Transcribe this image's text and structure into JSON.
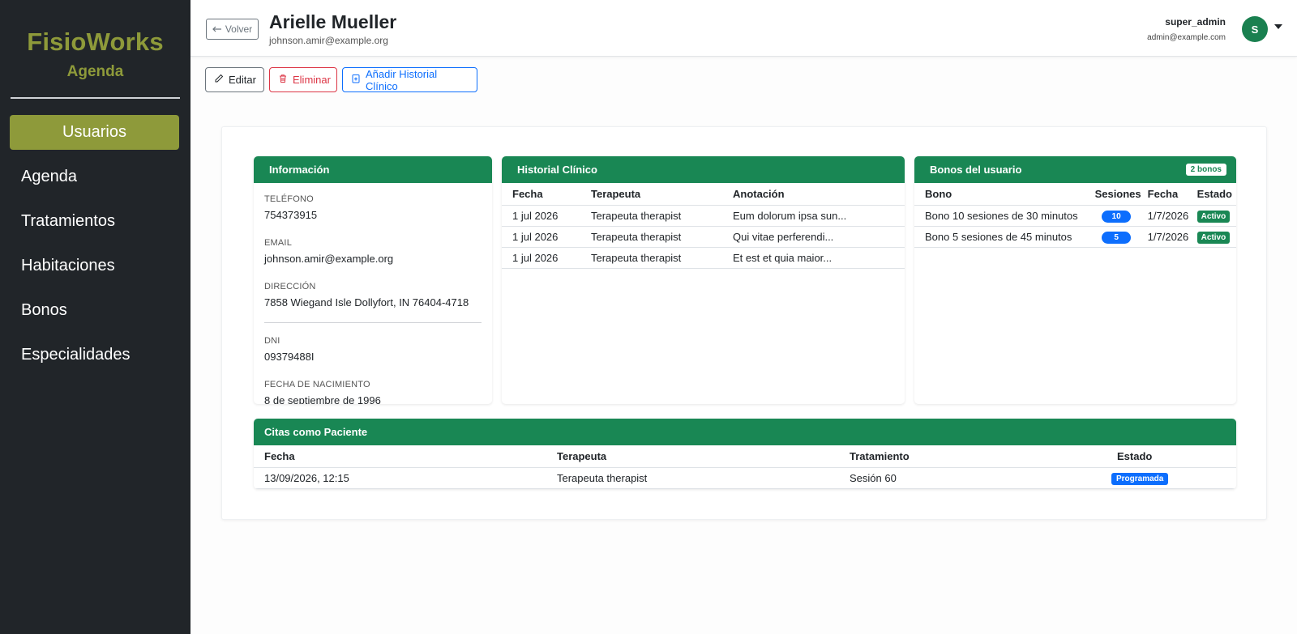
{
  "sidebar": {
    "brand_title": "FisioWorks",
    "brand_subtitle": "Agenda",
    "items": [
      {
        "label": "Usuarios",
        "active": true
      },
      {
        "label": "Agenda"
      },
      {
        "label": "Tratamientos"
      },
      {
        "label": "Habitaciones"
      },
      {
        "label": "Bonos"
      },
      {
        "label": "Especialidades"
      }
    ]
  },
  "header": {
    "back_label": "Volver",
    "title": "Arielle Mueller",
    "subtitle": "johnson.amir@example.org",
    "user_name": "super_admin",
    "user_email": "admin@example.com",
    "avatar_initial": "S"
  },
  "actions": {
    "edit_label": "Editar",
    "delete_label": "Eliminar",
    "add_history_label": "Añadir Historial Clínico"
  },
  "info": {
    "title": "Información",
    "phone_label": "TELÉFONO",
    "phone": "754373915",
    "email_label": "EMAIL",
    "email": "johnson.amir@example.org",
    "address_label": "DIRECCIÓN",
    "address": "7858 Wiegand Isle Dollyfort, IN 76404-4718",
    "dni_label": "DNI",
    "dni": "09379488I",
    "birth_label": "FECHA DE NACIMIENTO",
    "birth": "8 de septiembre de 1996"
  },
  "history": {
    "title": "Historial Clínico",
    "columns": [
      "Fecha",
      "Terapeuta",
      "Anotación"
    ],
    "rows": [
      [
        "1 jul 2026",
        "Terapeuta therapist",
        "Eum dolorum ipsa sun..."
      ],
      [
        "1 jul 2026",
        "Terapeuta therapist",
        "Qui vitae perferendi..."
      ],
      [
        "1 jul 2026",
        "Terapeuta therapist",
        "Et est et quia maior..."
      ]
    ]
  },
  "bonos": {
    "title": "Bonos del usuario",
    "count_badge": "2 bonos",
    "columns": [
      "Bono",
      "Sesiones",
      "Fecha",
      "Estado"
    ],
    "rows": [
      [
        "Bono 10 sesiones de 30 minutos",
        "10",
        "1/7/2026",
        "Activo"
      ],
      [
        "Bono 5 sesiones de 45 minutos",
        "5",
        "1/7/2026",
        "Activo"
      ]
    ]
  },
  "citas": {
    "title": "Citas como Paciente",
    "columns": [
      "Fecha",
      "Terapeuta",
      "Tratamiento",
      "Estado"
    ],
    "rows": [
      [
        "13/09/2026, 12:15",
        "Terapeuta therapist",
        "Sesión 60",
        "Programada"
      ]
    ]
  },
  "colors": {
    "sidebar_bg": "#212529",
    "brand_olive": "#8e9a3a",
    "card_header_green": "#198754",
    "primary_blue": "#0d6efd",
    "danger_red": "#dc3545"
  }
}
